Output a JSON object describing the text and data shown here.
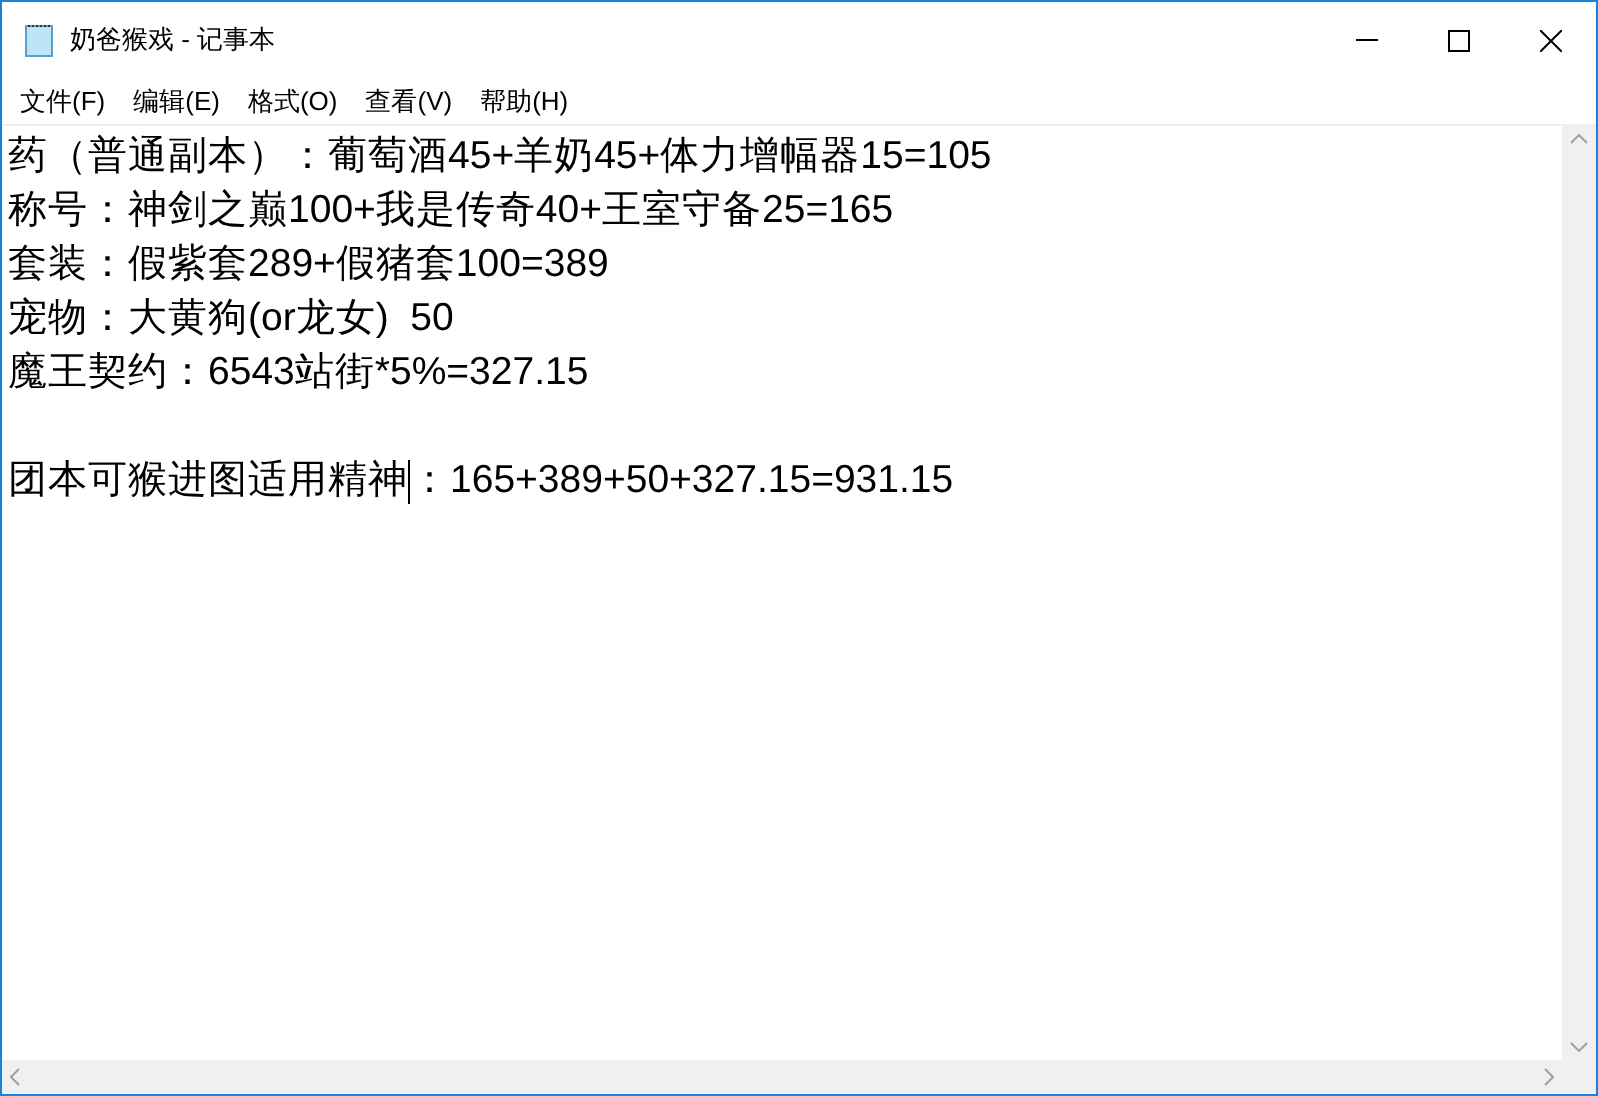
{
  "window": {
    "title": "奶爸猴戏 - 记事本"
  },
  "menu": [
    "文件(F)",
    "编辑(E)",
    "格式(O)",
    "查看(V)",
    "帮助(H)"
  ],
  "lines": [
    {
      "kind": "text",
      "text": "药（普通副本）：葡萄酒45+羊奶45+体力增幅器15=105"
    },
    {
      "kind": "text",
      "text": "称号：神剑之巅100+我是传奇40+王室守备25=165"
    },
    {
      "kind": "text",
      "text": "套装：假紫套289+假猪套100=389"
    },
    {
      "kind": "text",
      "text": "宠物：大黄狗(or龙女)  50"
    },
    {
      "kind": "text",
      "text": "魔王契约：6543站街*5%=327.15"
    },
    {
      "kind": "blank"
    },
    {
      "kind": "caret",
      "text": "团本可猴进图适用精神",
      "after": "：165+389+50+327.15=931.15"
    }
  ]
}
